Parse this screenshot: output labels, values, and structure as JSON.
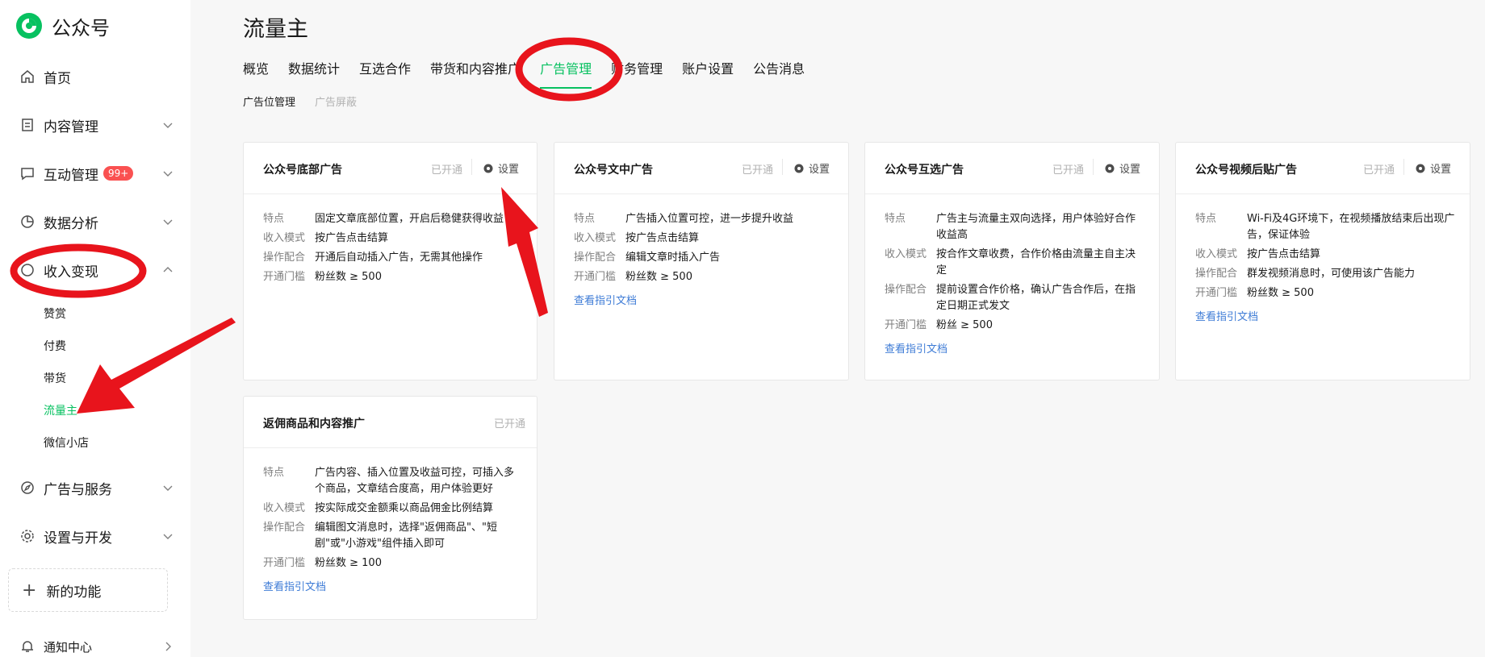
{
  "app": {
    "title": "公众号"
  },
  "sidebar": {
    "items": [
      {
        "label": "首页",
        "icon": "home-icon"
      },
      {
        "label": "内容管理",
        "icon": "document-icon"
      },
      {
        "label": "互动管理",
        "icon": "message-icon",
        "badge": "99+"
      },
      {
        "label": "数据分析",
        "icon": "chart-icon"
      },
      {
        "label": "收入变现",
        "icon": "money-icon"
      },
      {
        "label": "广告与服务",
        "icon": "compass-icon"
      },
      {
        "label": "设置与开发",
        "icon": "gear-icon"
      },
      {
        "label": "通知中心",
        "icon": "bell-icon"
      }
    ],
    "sub_items": [
      "赞赏",
      "付费",
      "带货",
      "流量主",
      "微信小店"
    ],
    "active_sub": "流量主",
    "new_feature": "新的功能"
  },
  "page": {
    "title": "流量主",
    "tabs": [
      "概览",
      "数据统计",
      "互选合作",
      "带货和内容推广",
      "广告管理",
      "财务管理",
      "账户设置",
      "公告消息"
    ],
    "active_tab": "广告管理",
    "subtabs": [
      "广告位管理",
      "广告屏蔽"
    ]
  },
  "labels": {
    "status": "已开通",
    "settings": "设置",
    "doc_link": "查看指引文档",
    "k_feature": "特点",
    "k_income": "收入模式",
    "k_operate": "操作配合",
    "k_threshold": "开通门槛"
  },
  "cards": [
    {
      "title": "公众号底部广告",
      "feature": "固定文章底部位置，开启后稳健获得收益",
      "income": "按广告点击结算",
      "operate": "开通后自动插入广告，无需其他操作",
      "threshold": "粉丝数 ≥ 500"
    },
    {
      "title": "公众号文中广告",
      "feature": "广告插入位置可控，进一步提升收益",
      "income": "按广告点击结算",
      "operate": "编辑文章时插入广告",
      "threshold": "粉丝数 ≥ 500"
    },
    {
      "title": "公众号互选广告",
      "feature": "广告主与流量主双向选择，用户体验好合作收益高",
      "income": "按合作文章收费，合作价格由流量主自主决定",
      "operate": "提前设置合作价格，确认广告合作后，在指定日期正式发文",
      "threshold": "粉丝 ≥ 500"
    },
    {
      "title": "公众号视频后贴广告",
      "feature": "Wi-Fi及4G环境下，在视频播放结束后出现广告，保证体验",
      "income": "按广告点击结算",
      "operate": "群发视频消息时，可使用该广告能力",
      "threshold": "粉丝数 ≥ 500"
    },
    {
      "title": "返佣商品和内容推广",
      "feature": "广告内容、插入位置及收益可控，可插入多个商品，文章结合度高，用户体验更好",
      "income": "按实际成交金额乘以商品佣金比例结算",
      "operate": "编辑图文消息时，选择\"返佣商品\"、\"短剧\"或\"小游戏\"组件插入即可",
      "threshold": "粉丝数 ≥ 100"
    }
  ],
  "colors": {
    "brand": "#07c160",
    "annotation": "#e8141c",
    "link": "#3d7bd6"
  }
}
